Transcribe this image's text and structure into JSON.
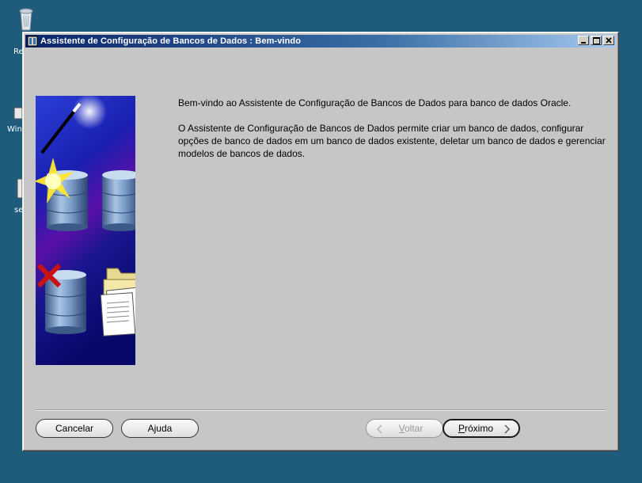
{
  "desktop": {
    "icons": [
      {
        "name": "recycle-bin",
        "label": "Re"
      },
      {
        "name": "windows",
        "label": "Win"
      },
      {
        "name": "setup",
        "label": "se"
      }
    ]
  },
  "window": {
    "title": "Assistente de Configuração de Bancos de Dados : Bem-vindo",
    "caption_buttons": [
      "minimize",
      "maximize",
      "close"
    ]
  },
  "content": {
    "intro": "Bem-vindo ao Assistente de Configuração de Bancos de Dados para banco de dados Oracle.",
    "description": "O Assistente de Configuração de Bancos de Dados permite criar um banco de dados, configurar opções de banco de dados em um banco de dados existente, deletar um banco de dados e gerenciar modelos de bancos de dados."
  },
  "buttons": {
    "cancel": "Cancelar",
    "help": "Ajuda",
    "back_prefix": "",
    "back_mnemonic": "V",
    "back_rest": "oltar",
    "next_prefix": "",
    "next_mnemonic": "P",
    "next_rest": "róximo"
  },
  "colors": {
    "desktop": "#1f5c7c",
    "titlebar_start": "#0a246a",
    "titlebar_end": "#a6caf0",
    "window_bg": "#c6c6c6",
    "check_red": "#cc1111"
  },
  "icons": [
    "wand-icon",
    "database-icon",
    "checkbox-icon",
    "x-mark-icon",
    "folder-icon",
    "documents-icon"
  ]
}
